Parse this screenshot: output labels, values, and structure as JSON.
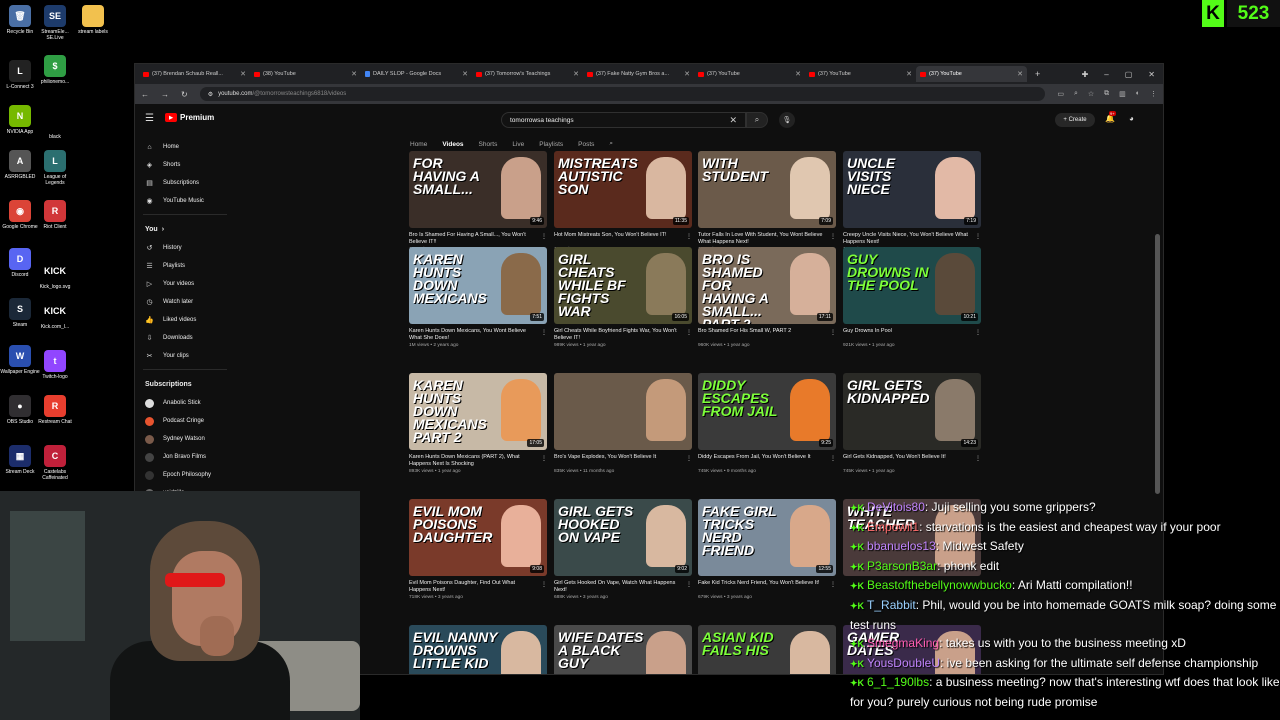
{
  "desktop": {
    "icons": [
      {
        "label": "Recycle Bin",
        "glyph": "🗑",
        "color": "#4a6fa5"
      },
      {
        "label": "StreamEle... SE.Live",
        "glyph": "SE",
        "color": "#1d3b6b"
      },
      {
        "label": "stream labels",
        "glyph": "",
        "color": "#f2c14e"
      },
      {
        "label": "L-Connect 3",
        "glyph": "L",
        "color": "#222"
      },
      {
        "label": "philionemo...",
        "glyph": "$",
        "color": "#2f9e44"
      },
      {
        "label": "NVIDIA App",
        "glyph": "N",
        "color": "#76b900"
      },
      {
        "label": "black",
        "glyph": "",
        "color": "#000"
      },
      {
        "label": "ASRRGBLED",
        "glyph": "A",
        "color": "#555"
      },
      {
        "label": "League of Legends",
        "glyph": "L",
        "color": "#2b6f70"
      },
      {
        "label": "Google Chrome",
        "glyph": "◉",
        "color": "#db4437"
      },
      {
        "label": "Riot Client",
        "glyph": "R",
        "color": "#d13639"
      },
      {
        "label": "Discord",
        "glyph": "D",
        "color": "#5865f2"
      },
      {
        "label": "Kick_logo.svg",
        "glyph": "KICK",
        "color": "#000"
      },
      {
        "label": "Steam",
        "glyph": "S",
        "color": "#1b2838"
      },
      {
        "label": "Kick.com_l...",
        "glyph": "KICK",
        "color": "#000"
      },
      {
        "label": "Wallpaper Engine",
        "glyph": "W",
        "color": "#2a4fb0"
      },
      {
        "label": "Twitch-logo",
        "glyph": "t",
        "color": "#9146ff"
      },
      {
        "label": "OBS Studio",
        "glyph": "●",
        "color": "#302e31"
      },
      {
        "label": "Restream Chat",
        "glyph": "R",
        "color": "#e83e2e"
      },
      {
        "label": "Stream Deck",
        "glyph": "▦",
        "color": "#1c2d6b"
      },
      {
        "label": "Castelabs Caffeinated",
        "glyph": "C",
        "color": "#c0203a"
      }
    ]
  },
  "kick": {
    "logo": "K",
    "count": "523"
  },
  "browser": {
    "tabs": [
      {
        "label": "(37) Brendan Schaub Reall...",
        "icon": "yt"
      },
      {
        "label": "(38) YouTube",
        "icon": "yt"
      },
      {
        "label": "DAILY SLOP - Google Docs",
        "icon": "gd"
      },
      {
        "label": "(37) Tomorrow's Teachings",
        "icon": "yt"
      },
      {
        "label": "(37) Fake Natty Gym Bros a...",
        "icon": "yt"
      },
      {
        "label": "(37) YouTube",
        "icon": "yt"
      },
      {
        "label": "(37) YouTube",
        "icon": "yt"
      },
      {
        "label": "(37) YouTube",
        "icon": "yt",
        "active": true
      }
    ],
    "url_host": "youtube.com",
    "url_path": "/@tomorrowsteachings6818/videos"
  },
  "youtube": {
    "brand": "Premium",
    "search_value": "tomorrowsa teachings",
    "create_label": "Create",
    "notif_count": "9+",
    "sidebar": {
      "main": [
        {
          "label": "Home",
          "icon": "⌂"
        },
        {
          "label": "Shorts",
          "icon": "◈"
        },
        {
          "label": "Subscriptions",
          "icon": "▤"
        },
        {
          "label": "YouTube Music",
          "icon": "◉"
        }
      ],
      "you_header": "You",
      "you": [
        {
          "label": "History",
          "icon": "↺"
        },
        {
          "label": "Playlists",
          "icon": "☰"
        },
        {
          "label": "Your videos",
          "icon": "▷"
        },
        {
          "label": "Watch later",
          "icon": "◷"
        },
        {
          "label": "Liked videos",
          "icon": "👍"
        },
        {
          "label": "Downloads",
          "icon": "⇩"
        },
        {
          "label": "Your clips",
          "icon": "✂"
        }
      ],
      "subs_header": "Subscriptions",
      "subs": [
        {
          "label": "Anabolic Stick",
          "color": "#ddd"
        },
        {
          "label": "Podcast Cringe",
          "color": "#e8542f"
        },
        {
          "label": "Sydney Watson",
          "color": "#7a5a4a"
        },
        {
          "label": "Jon Bravo Films",
          "color": "#444"
        },
        {
          "label": "Epoch Philosophy",
          "color": "#333"
        },
        {
          "label": "voidzilla",
          "color": "#666"
        }
      ]
    },
    "channel_tabs": [
      "Home",
      "Videos",
      "Shorts",
      "Live",
      "Playlists",
      "Posts"
    ],
    "videos": [
      {
        "thumb": "FOR HAVING A SMALL...",
        "green": false,
        "bg": "#3a2e28",
        "face": "#c9a08a",
        "dur": "9:46",
        "title": "Bro Is Shamed For Having A Small..., You Won't Believe IT!!",
        "meta": "1.5M views • 1 year ago"
      },
      {
        "thumb": "MISTREATS AUTISTIC SON",
        "green": false,
        "bg": "#5a2a1d",
        "face": "#d9b7a0",
        "dur": "11:35",
        "title": "Hot Mom Mistreats Son, You Won't Believe IT!",
        "meta": "1.4M views • 2 years ago"
      },
      {
        "thumb": "WITH STUDENT",
        "green": false,
        "bg": "#6b5a4a",
        "face": "#e0c7b0",
        "dur": "7:09",
        "title": "Tutor Falls In Love With Student, You Wont Believe What Happens Next!",
        "meta": "1.1M views • 3 years ago"
      },
      {
        "thumb": "UNCLE VISITS NIECE",
        "green": false,
        "bg": "#2a2f3a",
        "face": "#e2b9a6",
        "dur": "7:19",
        "title": "Creepy Uncle Visits Niece, You Won't Believe What Happens Next!",
        "meta": "1.1M views • 3 years ago"
      },
      {
        "thumb": "KAREN HUNTS DOWN MEXICANS",
        "green": false,
        "bg": "#8aa3b5",
        "face": "#8a6a4a",
        "dur": "7:51",
        "title": "Karen Hunts Down Mexicans, You Wont Believe What She Does!",
        "meta": "1M views • 2 years ago"
      },
      {
        "thumb": "GIRL CHEATS WHILE BF FIGHTS WAR",
        "green": false,
        "bg": "#4a4a2e",
        "face": "#8a7a5a",
        "dur": "16:05",
        "title": "Girl Cheats While Boyfriend Fights War, You Won't Believe IT!",
        "meta": "989K views • 1 year ago"
      },
      {
        "thumb": "BRO IS SHAMED FOR HAVING A SMALL... PART 2",
        "green": false,
        "bg": "#7a6a5a",
        "face": "#d6b09a",
        "dur": "17:11",
        "title": "Bro Shamed For His Small W, PART 2",
        "meta": "960K views • 1 year ago"
      },
      {
        "thumb": "GUY DROWNS IN THE POOL",
        "green": true,
        "bg": "#1f4a4a",
        "face": "#5a4a3a",
        "dur": "10:21",
        "title": "Guy Drowns In Pool",
        "meta": "921K views • 1 year ago"
      },
      {
        "thumb": "KAREN HUNTS DOWN MEXICANS PART 2",
        "green": false,
        "bg": "#c7b9a6",
        "face": "#e89a5a",
        "dur": "17:05",
        "title": "Karen Hunts Down Mexicans (PART 2), What Happens Next Is Shocking",
        "meta": "893K views • 1 year ago"
      },
      {
        "thumb": "",
        "green": false,
        "bg": "#6a5a4a",
        "face": "#c49a7a",
        "dur": "",
        "title": "Bro's Vape Explodes, You Won't Believe It",
        "meta": "835K views • 11 months ago"
      },
      {
        "thumb": "DIDDY ESCAPES FROM JAIL",
        "green": true,
        "bg": "#3a3a3a",
        "face": "#e87a2a",
        "dur": "9:25",
        "title": "Diddy Escapes From Jail, You Won't Believe It",
        "meta": "745K views • 9 months ago"
      },
      {
        "thumb": "GIRL GETS KIDNAPPED",
        "green": false,
        "bg": "#2a2a26",
        "face": "#8a7a6a",
        "dur": "14:23",
        "title": "Girl Gets Kidnapped, You Won't Believe It!",
        "meta": "745K views • 1 year ago"
      },
      {
        "thumb": "EVIL MOM POISONS DAUGHTER",
        "green": false,
        "bg": "#7a3a2a",
        "face": "#e8b09a",
        "dur": "9:08",
        "title": "Evil Mom Poisons Daughter, Find Out What Happens Next!",
        "meta": "718K views • 3 years ago"
      },
      {
        "thumb": "GIRL GETS HOOKED ON VAPE",
        "green": false,
        "bg": "#3a4a4a",
        "face": "#d8b8a0",
        "dur": "9:02",
        "title": "Girl Gets Hooked On Vape, Watch What Happens Next!",
        "meta": "688K views • 3 years ago"
      },
      {
        "thumb": "FAKE GIRL TRICKS NERD FRIEND",
        "green": false,
        "bg": "#7a8a9a",
        "face": "#d8a88a",
        "dur": "12:55",
        "title": "Fake Kid Tricks Nerd Friend, You Won't Believe It!",
        "meta": "679K views • 3 years ago"
      },
      {
        "thumb": "WHITE TEACHER",
        "green": false,
        "bg": "#4a3a3a",
        "face": "#c9a08a",
        "dur": "",
        "title": "",
        "meta": ""
      },
      {
        "thumb": "EVIL NANNY DROWNS LITTLE KID",
        "green": false,
        "bg": "#2a4a5a",
        "face": "#d8b8a0",
        "dur": "",
        "title": "",
        "meta": ""
      },
      {
        "thumb": "WIFE DATES A BLACK GUY",
        "green": false,
        "bg": "#4a4a4a",
        "face": "#c9a08a",
        "dur": "",
        "title": "",
        "meta": ""
      },
      {
        "thumb": "ASIAN KID FAILS HIS",
        "green": true,
        "bg": "#3a3a3a",
        "face": "#d8b8a0",
        "dur": "",
        "title": "",
        "meta": ""
      },
      {
        "thumb": "GAMER DATES",
        "green": false,
        "bg": "#3a2a4a",
        "face": "#c9a08a",
        "dur": "",
        "title": "",
        "meta": ""
      }
    ]
  },
  "chat": [
    {
      "user": "DeVitois80",
      "color": "#c084fc",
      "msg": "Juji selling you some grippers?"
    },
    {
      "user": "Empowil1",
      "color": "#ff6b6b",
      "msg": "starvations is the easiest and cheapest way if your poor"
    },
    {
      "user": "bbanuelos13",
      "color": "#c084fc",
      "msg": "Midwest Safety"
    },
    {
      "user": "P3arsonB3ar",
      "color": "#53fc18",
      "msg": "phonk edit"
    },
    {
      "user": "Beastofthebellynowwbucko",
      "color": "#53fc18",
      "msg": "Ari Matti compilation!!"
    },
    {
      "user": "T_Rabbit",
      "color": "#9ad1ff",
      "msg": "Phil, would you be into homemade GOATS milk soap? doing some test runs"
    },
    {
      "user": "SmegmaKing",
      "color": "#ff5db1",
      "msg": "takes us with you to the business meeting xD"
    },
    {
      "user": "YousDoubleU",
      "color": "#c084fc",
      "msg": "ive been asking for the ultimate self defense championship"
    },
    {
      "user": "6_1_190lbs",
      "color": "#53fc18",
      "msg": "a business meeting? now that's interesting wtf does that look like for you? purely curious not being rude promise"
    }
  ]
}
